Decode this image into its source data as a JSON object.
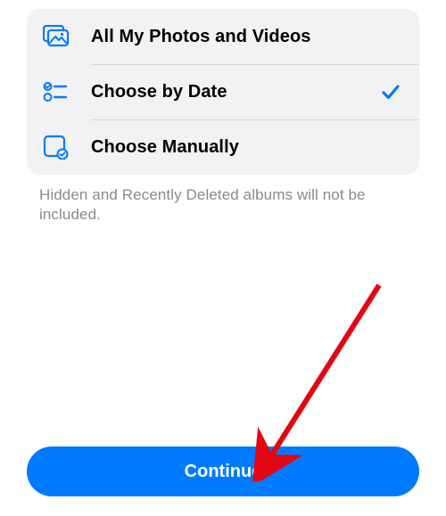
{
  "options": {
    "all": {
      "label": "All My Photos and Videos",
      "selected": false
    },
    "byDate": {
      "label": "Choose by Date",
      "selected": true
    },
    "manual": {
      "label": "Choose Manually",
      "selected": false
    }
  },
  "footnote": "Hidden and Recently Deleted albums will not be included.",
  "continue_label": "Continue",
  "colors": {
    "accent": "#007aff"
  }
}
